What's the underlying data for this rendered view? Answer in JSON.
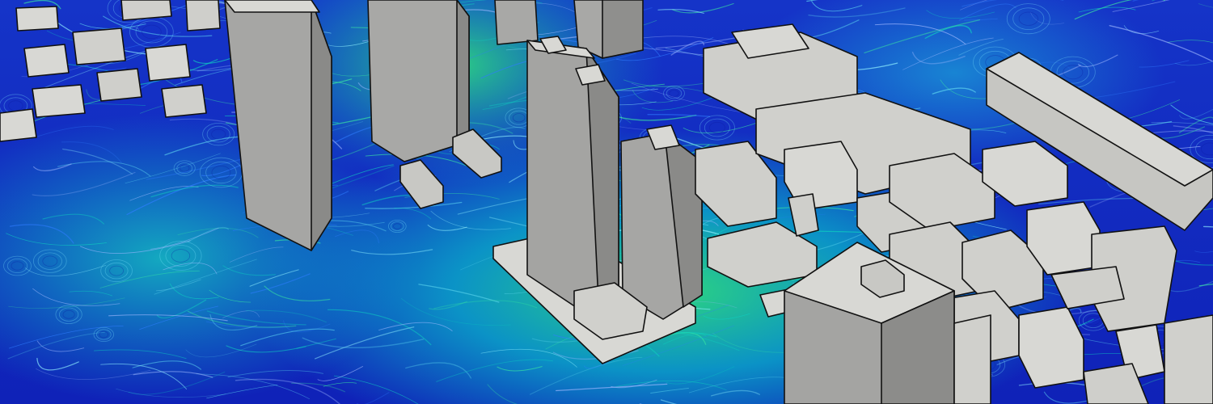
{
  "scene": {
    "subject": "wind-flow-visualization-over-city-blocks",
    "colors": {
      "flow_low": "#0f22b8",
      "flow_mid": "#0aa6c8",
      "flow_high": "#2fe07a",
      "building_light": "#d8d8d4",
      "building_mid": "#a8a8a6",
      "building_dark": "#7c7c7a",
      "edge": "#111111"
    }
  }
}
